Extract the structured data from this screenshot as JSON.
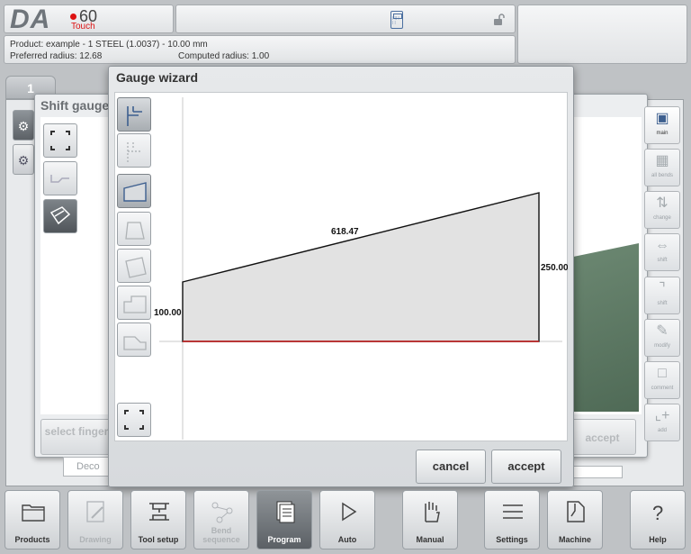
{
  "header": {
    "logo": {
      "brand": "DA",
      "model": "60",
      "variant": "Touch"
    },
    "product_line": "Product: example - 1 STEEL (1.0037) - 10.00 mm",
    "preferred_radius": "Preferred radius: 12.68",
    "computed_radius": "Computed radius: 1.00"
  },
  "tab": {
    "label": "1"
  },
  "shift_gauge": {
    "title": "Shift gauge",
    "select_finger_label": "select finger",
    "accept_label": "accept",
    "deco_label": "Deco"
  },
  "right_bar": {
    "items": [
      "main",
      "all bends",
      "change",
      "shift",
      "shift",
      "modify",
      "comment",
      "add"
    ]
  },
  "wizard": {
    "title": "Gauge wizard",
    "dimensions": {
      "top_length": "618.47",
      "left_height": "100.00",
      "right_height": "250.00"
    },
    "cancel_label": "cancel",
    "accept_label": "accept"
  },
  "nav": {
    "items": [
      {
        "label": "Products",
        "icon": "folder-icon",
        "state": "normal"
      },
      {
        "label": "Drawing",
        "icon": "drawing-icon",
        "state": "disabled"
      },
      {
        "label": "Tool setup",
        "icon": "tool-setup-icon",
        "state": "normal"
      },
      {
        "label": "Bend sequence",
        "icon": "bend-sequence-icon",
        "state": "disabled"
      },
      {
        "label": "Program",
        "icon": "program-icon",
        "state": "active"
      },
      {
        "label": "Auto",
        "icon": "play-icon",
        "state": "normal"
      },
      {
        "label": "Manual",
        "icon": "hand-icon",
        "state": "normal"
      },
      {
        "label": "Settings",
        "icon": "settings-list-icon",
        "state": "normal"
      },
      {
        "label": "Machine",
        "icon": "machine-icon",
        "state": "normal"
      },
      {
        "label": "Help",
        "icon": "help-icon",
        "state": "normal"
      }
    ]
  },
  "colors": {
    "accent_red": "#d11111",
    "part_fill": "#e2e2e2",
    "baseline_red": "#cc1f1f"
  }
}
